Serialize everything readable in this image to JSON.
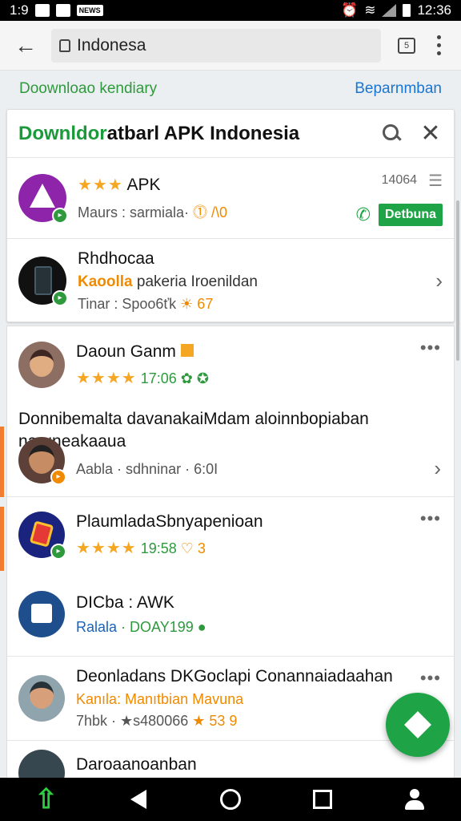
{
  "status_bar": {
    "time": "12:36",
    "left_text": "1:9",
    "badge": "NEWS"
  },
  "browser": {
    "url": "Indonesa"
  },
  "page_header": {
    "left": "Doownloao kendiary",
    "right": "Beparnmban"
  },
  "search_card": {
    "title_green": "Downldor",
    "title_rest": "atbarl APK Indonesia",
    "rows": [
      {
        "stars": "★★★",
        "title": "APK",
        "meta": "Maurs : sarmiala·",
        "meta2": "⓵ /\\0",
        "count": "14064",
        "button": "Detbuna",
        "colors": {
          "avatar": "#8e24aa",
          "badge": "#2e9a3d"
        }
      },
      {
        "title": "Rhdhocaa",
        "sub_orange": "Kaoolla",
        "sub_rest": " pakeria Iroenildan",
        "meta": "Tinar : Spoo6ťk",
        "meta2": "☀ 67"
      }
    ]
  },
  "list": [
    {
      "title": "Daoun Ganm",
      "stars": "★★★★",
      "time": "17:06",
      "extra": "✿ ✪",
      "badge_color": "#2e9a3d"
    },
    {
      "title": "Donnibemalta davanakaiMdam aloinnbopiaban naruneakaaua",
      "meta": "Aabla · sdhninar · 6:0I",
      "badge_color": "#f08a00"
    },
    {
      "title": "PlaumladaSbnyapenioan",
      "stars": "★★★★",
      "time": "19:58",
      "extra": "♡ 3",
      "badge_color": "#2e9a3d"
    },
    {
      "title": "DICba : AWK",
      "sub_blue": "Ralala",
      "sub_rest": " · DOAY199",
      "extra": "●"
    },
    {
      "title": "Deonladans DKGoclapi Conannaiadaahan",
      "sub_orange": "Kanıla: Manıtbian",
      "sub_rest": " Mavuna",
      "meta": "7hbk · ★s480066",
      "extra": "★ 53 9"
    },
    {
      "title": "Daroaanoanban"
    }
  ],
  "colors": {
    "accent_green": "#1ea446",
    "accent_orange": "#f08a00",
    "link_blue": "#1976d2"
  }
}
